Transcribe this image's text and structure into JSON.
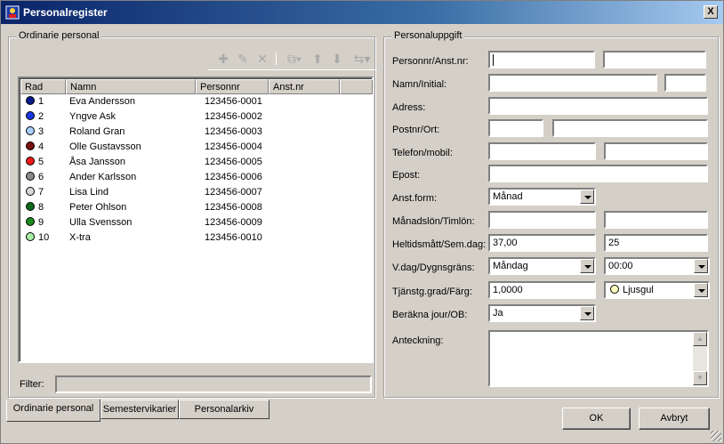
{
  "window": {
    "title": "Personalregister",
    "close_label": "X"
  },
  "left_group": {
    "legend": "Ordinarie personal"
  },
  "toolbar": {
    "icons": [
      "add-icon",
      "edit-icon",
      "delete-icon",
      "copy-icon",
      "move-up-icon",
      "move-down-icon",
      "sort-icon"
    ]
  },
  "list": {
    "columns": [
      "Rad",
      "Namn",
      "Personnr",
      "Anst.nr"
    ],
    "rows": [
      {
        "rad": "1",
        "namn": "Eva Andersson",
        "personnr": "123456-0001",
        "anstnr": "",
        "color": "#0a1a8c"
      },
      {
        "rad": "2",
        "namn": "Yngve Ask",
        "personnr": "123456-0002",
        "anstnr": "",
        "color": "#1a36e0"
      },
      {
        "rad": "3",
        "namn": "Roland Gran",
        "personnr": "123456-0003",
        "anstnr": "",
        "color": "#a8d0ff"
      },
      {
        "rad": "4",
        "namn": "Olle Gustavsson",
        "personnr": "123456-0004",
        "anstnr": "",
        "color": "#7a1010"
      },
      {
        "rad": "5",
        "namn": "Åsa Jansson",
        "personnr": "123456-0005",
        "anstnr": "",
        "color": "#f01818"
      },
      {
        "rad": "6",
        "namn": "Ander Karlsson",
        "personnr": "123456-0006",
        "anstnr": "",
        "color": "#8a8a8a"
      },
      {
        "rad": "7",
        "namn": "Lisa Lind",
        "personnr": "123456-0007",
        "anstnr": "",
        "color": "#d8d8d8"
      },
      {
        "rad": "8",
        "namn": "Peter Ohlson",
        "personnr": "123456-0008",
        "anstnr": "",
        "color": "#0a6a1a"
      },
      {
        "rad": "9",
        "namn": "Ulla Svensson",
        "personnr": "123456-0009",
        "anstnr": "",
        "color": "#1a8a1a"
      },
      {
        "rad": "10",
        "namn": "X-tra",
        "personnr": "123456-0010",
        "anstnr": "",
        "color": "#a8f0a8"
      }
    ]
  },
  "filter": {
    "label": "Filter:",
    "value": ""
  },
  "tabs": [
    "Ordinarie personal",
    "Semestervikarier",
    "Personalarkiv"
  ],
  "right_group": {
    "legend": "Personaluppgift"
  },
  "form": {
    "personnr_label": "Personnr/Anst.nr:",
    "personnr_value": "",
    "anstnr_value": "",
    "namn_label": "Namn/Initial:",
    "namn_value": "",
    "initial_value": "",
    "adress_label": "Adress:",
    "adress_value": "",
    "postnr_label": "Postnr/Ort:",
    "postnr_value": "",
    "ort_value": "",
    "telefon_label": "Telefon/mobil:",
    "telefon_value": "",
    "mobil_value": "",
    "epost_label": "Epost:",
    "epost_value": "",
    "anstform_label": "Anst.form:",
    "anstform_value": "Månad",
    "manadslon_label": "Månadslön/Timlön:",
    "manadslon_value": "",
    "timlon_value": "",
    "heltid_label": "Heltidsmått/Sem.dag:",
    "heltid_value": "37,00",
    "semdag_value": "25",
    "vdag_label": "V.dag/Dygnsgräns:",
    "vdag_value": "Måndag",
    "dygnsgrans_value": "00:00",
    "tjanstg_label": "Tjänstg.grad/Färg:",
    "tjanstg_value": "1,0000",
    "farg_value": "Ljusgul",
    "farg_color": "#ffffc0",
    "berakna_label": "Beräkna jour/OB:",
    "berakna_value": "Ja",
    "anteckning_label": "Anteckning:",
    "anteckning_value": ""
  },
  "buttons": {
    "ok": "OK",
    "cancel": "Avbryt"
  }
}
